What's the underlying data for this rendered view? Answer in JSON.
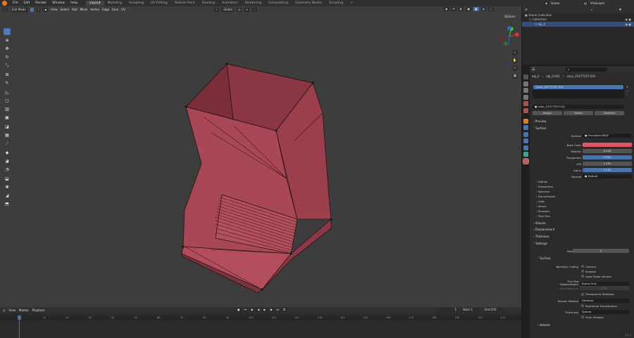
{
  "menu": [
    "File",
    "Edit",
    "Render",
    "Window",
    "Help"
  ],
  "workspaces": [
    "Layout",
    "Modeling",
    "Sculpting",
    "UV Editing",
    "Texture Paint",
    "Shading",
    "Animation",
    "Rendering",
    "Compositing",
    "Geometry Nodes",
    "Scripting"
  ],
  "active_workspace": "Layout",
  "scene": {
    "name": "Scene",
    "view_layer": "ViewLayer"
  },
  "viewport": {
    "mode": "Edit Mode",
    "header_menus": [
      "View",
      "Select",
      "Add",
      "Mesh",
      "Vertex",
      "Edge",
      "Face",
      "UV"
    ],
    "orientation": "Global",
    "options_label": "Options"
  },
  "timeline": {
    "menus": [
      "View",
      "Marker",
      "Playback"
    ],
    "current_frame": "1",
    "start_label": "Start",
    "start": "1",
    "end_label": "End",
    "end": "250",
    "ruler": [
      "1",
      "10",
      "20",
      "30",
      "40",
      "50",
      "60",
      "70",
      "80",
      "90",
      "100",
      "110",
      "120",
      "130",
      "140",
      "150",
      "160",
      "170",
      "180",
      "190",
      "200",
      "210",
      "220"
    ]
  },
  "outliner": {
    "items": [
      {
        "label": "Scene Collection"
      },
      {
        "label": "Collection"
      },
      {
        "label": "obj_0"
      }
    ]
  },
  "properties": {
    "breadcrumb": [
      "obj_0",
      "obj_0.001",
      "color_25277357.001"
    ],
    "slot": "color_25277357.001",
    "material_name": "color_25277357.001",
    "buttons": [
      "Assign",
      "Select",
      "Deselect"
    ],
    "sections": {
      "preview": "Preview",
      "surface": "Surface",
      "volume": "Volume",
      "displacement": "Displacement",
      "thickness": "Thickness",
      "settings": "Settings",
      "surface_sub": "Surface",
      "volume_sub": "Volume"
    },
    "surface": {
      "label": "Surface",
      "value": "Principled BSDF"
    },
    "fields": [
      {
        "label": "Base Color",
        "value": "",
        "kind": "color",
        "color": "#e0566a"
      },
      {
        "label": "Metallic",
        "value": "0.000",
        "kind": "num"
      },
      {
        "label": "Roughness",
        "value": "0.500",
        "kind": "blue"
      },
      {
        "label": "IOR",
        "value": "1.450",
        "kind": "num"
      },
      {
        "label": "Alpha",
        "value": "1.000",
        "kind": "blue"
      },
      {
        "label": "Normal",
        "value": "Default",
        "kind": "text"
      }
    ],
    "subpanels": [
      "Diffuse",
      "Subsurface",
      "Specular",
      "Transmission",
      "Coat",
      "Sheen",
      "Emission",
      "Thin Film"
    ],
    "pass_index": {
      "label": "Pass Index",
      "value": "0"
    },
    "backface_culling": {
      "label": "Backface Culling",
      "options": [
        "Camera",
        "Shadow",
        "Light Probe Volume"
      ]
    },
    "thin_film_row": "Thin Film",
    "displacement": {
      "label": "Displacement",
      "value": "Bump Only"
    },
    "max_distance": {
      "label": "Max Distance",
      "value": "0 m"
    },
    "transparent_shadows": "Transparent Shadows",
    "render_method": {
      "label": "Render Method",
      "value": "Dithered"
    },
    "raytraced_transmission": "Raytraced Transmission",
    "thickness": {
      "label": "Thickness",
      "value": "Sphere"
    },
    "from_shadow": "From Shadow"
  },
  "version": "4.2.1",
  "colors": {
    "accent": "#4772b3",
    "mesh": "#a34654",
    "base_color": "#e0566a",
    "orange": "#e87d0d"
  }
}
